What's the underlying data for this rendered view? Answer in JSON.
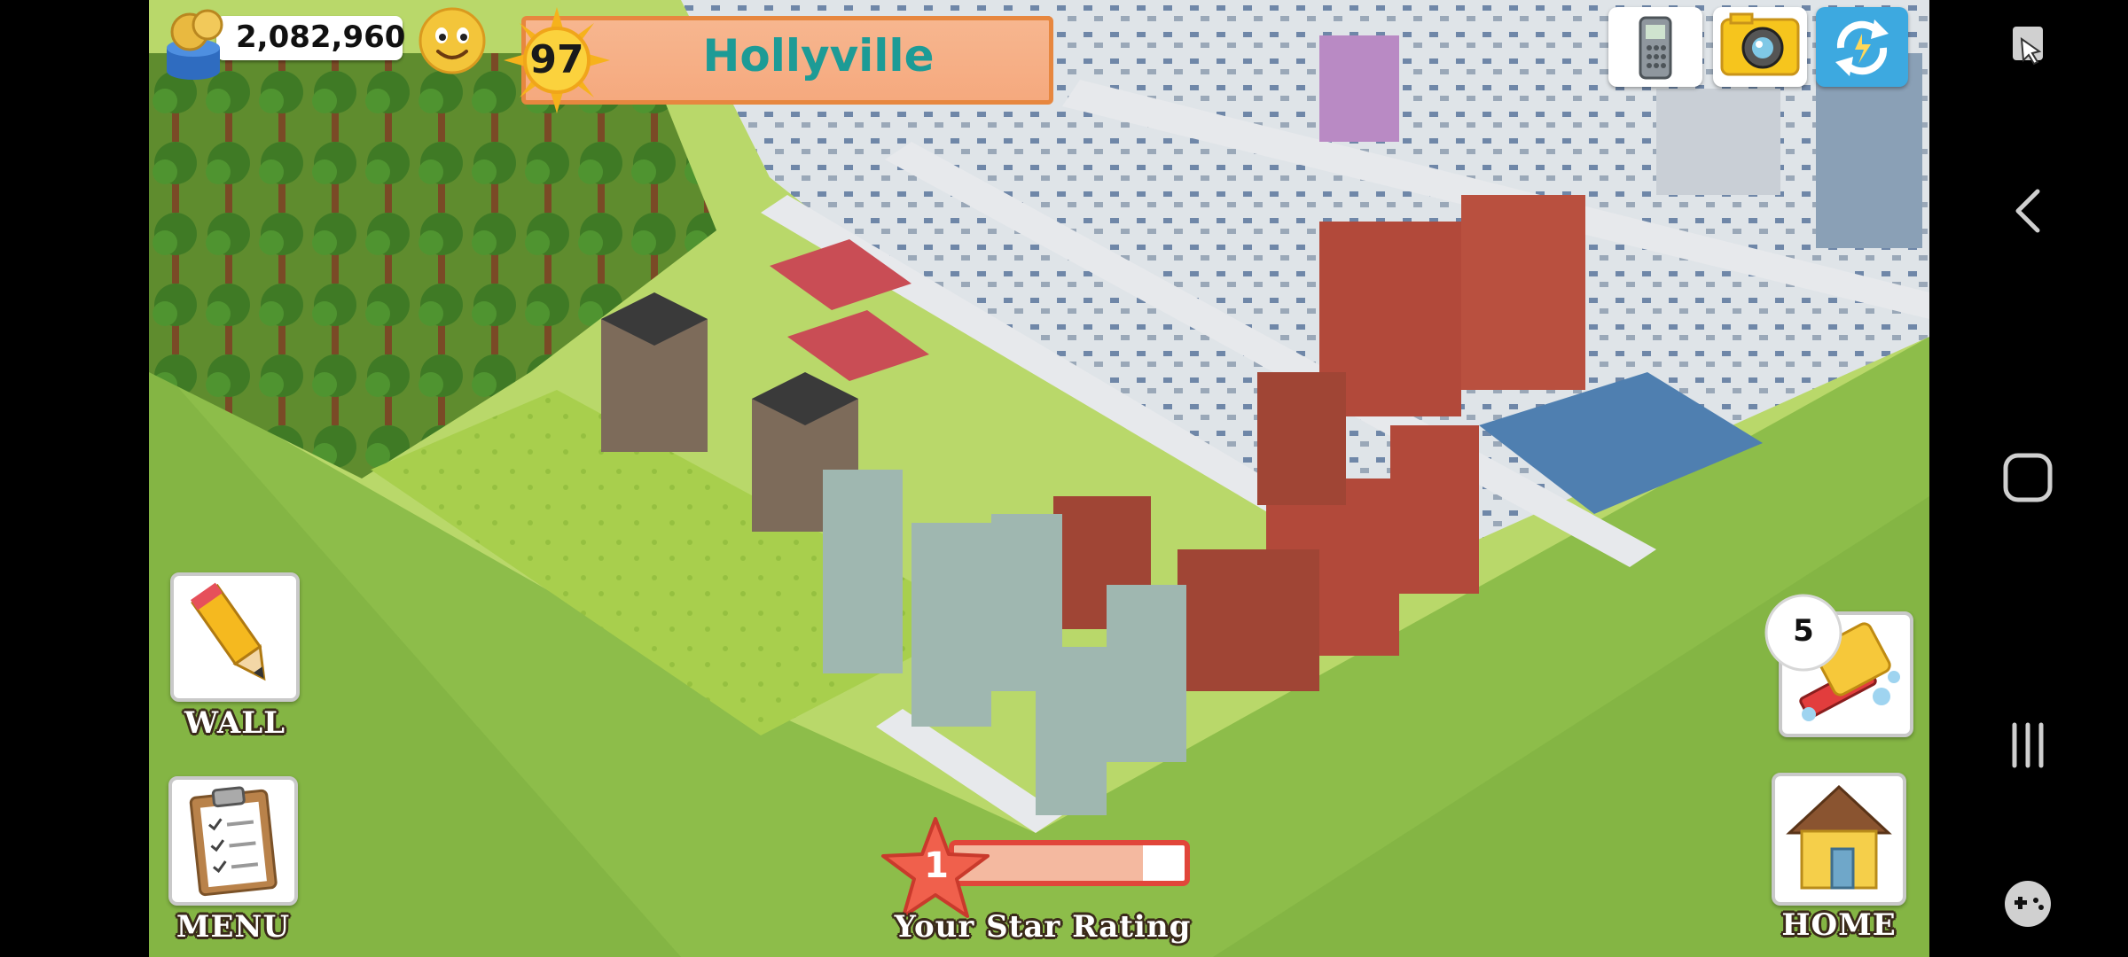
{
  "hud": {
    "coins": "2,082,960",
    "level": "97",
    "town_name": "Hollyville",
    "icons": {
      "coins": "coin-stack-icon",
      "happiness": "smiley-face-icon",
      "level": "sun-badge-icon"
    }
  },
  "top_buttons": [
    {
      "name": "phone",
      "icon": "phone-icon"
    },
    {
      "name": "camera",
      "icon": "camera-icon"
    },
    {
      "name": "sync",
      "icon": "sync-icon"
    }
  ],
  "left_buttons": {
    "wall": {
      "label": "WALL",
      "icon": "pencil-icon"
    },
    "menu": {
      "label": "MENU",
      "icon": "clipboard-icon"
    }
  },
  "right_buttons": {
    "cleanup": {
      "count": "5",
      "icon": "mop-bucket-icon"
    },
    "home": {
      "label": "HOME",
      "icon": "house-icon"
    }
  },
  "star_rating": {
    "label": "Your Star Rating",
    "stars": "1",
    "progress_percent": 82
  },
  "system_nav": {
    "icons": [
      "screen-capture-icon",
      "back-icon",
      "home-square-icon",
      "recents-icon",
      "game-tools-icon"
    ]
  },
  "colors": {
    "accent_teal": "#1d9b96",
    "bar_peach": "#f5a97e",
    "star_red": "#e1463a",
    "grass": "#8dbd4a"
  }
}
